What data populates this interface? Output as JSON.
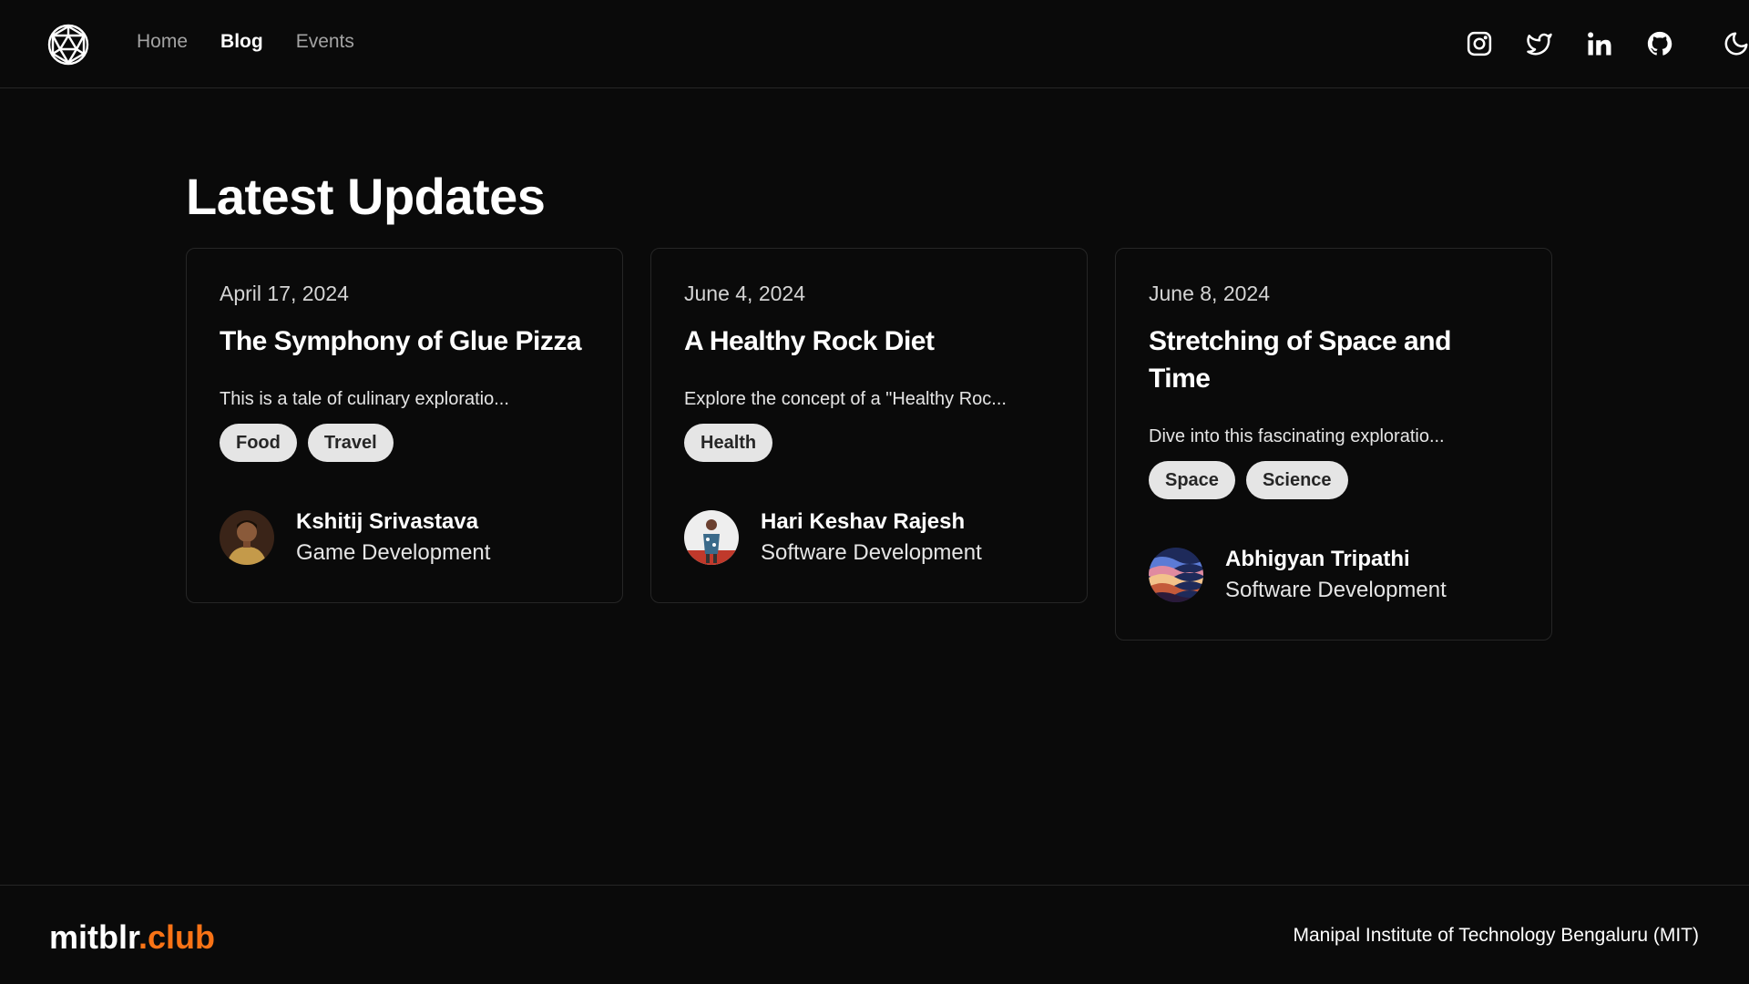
{
  "nav": {
    "items": [
      {
        "label": "Home",
        "active": false
      },
      {
        "label": "Blog",
        "active": true
      },
      {
        "label": "Events",
        "active": false
      }
    ]
  },
  "socials": [
    "instagram-icon",
    "twitter-icon",
    "linkedin-icon",
    "github-icon"
  ],
  "theme_toggle": "moon-icon",
  "main": {
    "title": "Latest Updates",
    "posts": [
      {
        "date": "April 17, 2024",
        "title": "The Symphony of Glue Pizza",
        "excerpt": "This is a tale of culinary exploratio...",
        "tags": [
          "Food",
          "Travel"
        ],
        "author": {
          "name": "Kshitij Srivastava",
          "role": "Game Development"
        }
      },
      {
        "date": "June 4, 2024",
        "title": "A Healthy Rock Diet",
        "excerpt": "Explore the concept of a \"Healthy Roc...",
        "tags": [
          "Health"
        ],
        "author": {
          "name": "Hari Keshav Rajesh",
          "role": "Software Development"
        }
      },
      {
        "date": "June 8, 2024",
        "title": "Stretching of Space and Time",
        "excerpt": "Dive into this fascinating exploratio...",
        "tags": [
          "Space",
          "Science"
        ],
        "author": {
          "name": "Abhigyan Tripathi",
          "role": "Software Development"
        }
      }
    ]
  },
  "footer": {
    "brand_main": "mitblr",
    "brand_accent": ".club",
    "institute": "Manipal Institute of Technology Bengaluru (MIT)"
  },
  "colors": {
    "background": "#0a0a0a",
    "border": "#262626",
    "accent": "#f97316",
    "tag_bg": "#e5e5e5"
  }
}
